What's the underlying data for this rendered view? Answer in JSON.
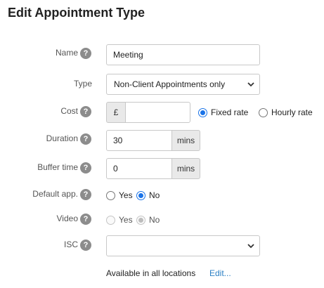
{
  "page": {
    "title": "Edit Appointment Type"
  },
  "help_glyph": "?",
  "fields": {
    "name": {
      "label": "Name",
      "value": "Meeting"
    },
    "type": {
      "label": "Type",
      "selected": "Non-Client Appointments only"
    },
    "cost": {
      "label": "Cost",
      "currency": "£",
      "value": "",
      "options": [
        "Fixed rate",
        "Hourly rate"
      ],
      "selected": "Fixed rate"
    },
    "duration": {
      "label": "Duration",
      "value": "30",
      "unit": "mins"
    },
    "buffer": {
      "label": "Buffer time",
      "value": "0",
      "unit": "mins"
    },
    "default_app": {
      "label": "Default app.",
      "yes": "Yes",
      "no": "No",
      "selected": "No"
    },
    "video": {
      "label": "Video",
      "yes": "Yes",
      "no": "No",
      "selected": "No",
      "disabled": true
    },
    "isc": {
      "label": "ISC",
      "selected": ""
    }
  },
  "locations": {
    "text": "Available in all locations",
    "edit_link": "Edit..."
  },
  "colors": {
    "accent": "#1a73e8",
    "link": "#2a7fc4",
    "help_bg": "#8c8c8c",
    "addon_bg": "#e9e9e9"
  },
  "icons": {
    "help": "question-circle-icon",
    "dropdown": "chevron-down-icon"
  }
}
